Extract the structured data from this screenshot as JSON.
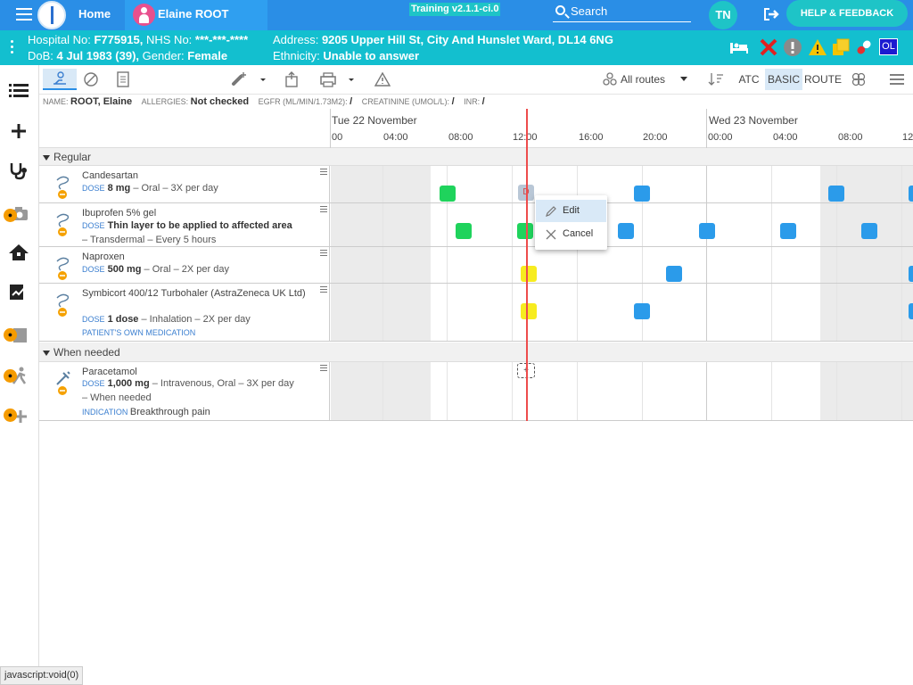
{
  "topbar": {
    "home_label": "Home",
    "patient_name": "Elaine ROOT",
    "env_badge": "Training v2.1.1-ci.0",
    "search_placeholder": "Search",
    "user_initials": "TN",
    "help_label": "HELP & FEEDBACK"
  },
  "banner": {
    "hospital_label": "Hospital No:",
    "hospital_no": "F775915,",
    "nhs_label": "NHS No:",
    "nhs_no": "***-***-****",
    "dob_label": "DoB:",
    "dob": "4 Jul 1983 (39),",
    "gender_label": "Gender:",
    "gender": "Female",
    "address_label": "Address:",
    "address": "9205 Upper Hill St, City And Hunslet Ward, DL14 6NG",
    "ethnicity_label": "Ethnicity:",
    "ethnicity": "Unable to answer",
    "alert_ol": "OL"
  },
  "toolbar": {
    "routes_label": "All routes",
    "atc": "ATC",
    "basic": "BASIC",
    "route": "ROUTE"
  },
  "info": {
    "name_label": "NAME:",
    "name": "ROOT, Elaine",
    "allergies_label": "ALLERGIES:",
    "allergies": "Not checked",
    "egfr_label": "EGFR (ML/MIN/1.73M2):",
    "egfr": "/",
    "creat_label": "CREATININE (UMOL/L):",
    "creat": "/",
    "inr_label": "INR:",
    "inr": "/"
  },
  "timeline": {
    "day1": "Tue 22 November",
    "day2": "Wed 23 November",
    "hours": [
      "00",
      "04:00",
      "08:00",
      "12:00",
      "16:00",
      "20:00",
      "00:00",
      "04:00",
      "08:00",
      "12"
    ]
  },
  "sections": {
    "regular": "Regular",
    "when_needed": "When needed"
  },
  "meds": [
    {
      "name": "Candesartan",
      "dose_key": "DOSE",
      "dose": "8 mg",
      "rest": " – Oral – 3X per day"
    },
    {
      "name": "Ibuprofen 5% gel",
      "dose_key": "DOSE",
      "dose": "Thin layer to be applied to affected area",
      "rest": "– Transdermal – Every 5 hours"
    },
    {
      "name": "Naproxen",
      "dose_key": "DOSE",
      "dose": "500 mg",
      "rest": " – Oral – 2X per day"
    },
    {
      "name": "Symbicort 400/12 Turbohaler (AstraZeneca UK Ltd)",
      "dose_key": "DOSE",
      "dose": "1 dose",
      "rest": " – Inhalation – 2X per day",
      "note": "PATIENT'S OWN MEDICATION"
    },
    {
      "name": "Paracetamol",
      "dose_key": "DOSE",
      "dose": "1,000 mg",
      "rest": " – Intravenous, Oral – 3X per day",
      "rest2": "– When needed",
      "note_key": "INDICATION",
      "note": "Breakthrough pain"
    }
  ],
  "grid_marks": {
    "draft_label": "D",
    "add_label": "+"
  },
  "context_menu": {
    "edit": "Edit",
    "cancel": "Cancel"
  },
  "status_bar": "javascript:void(0)",
  "colors": {
    "topbar": "#2a8ee6",
    "banner": "#13bfcf",
    "given": "#1fd35c",
    "scheduled": "#2b9bea",
    "due": "#f7ec1f",
    "now": "#ee4c4c"
  }
}
